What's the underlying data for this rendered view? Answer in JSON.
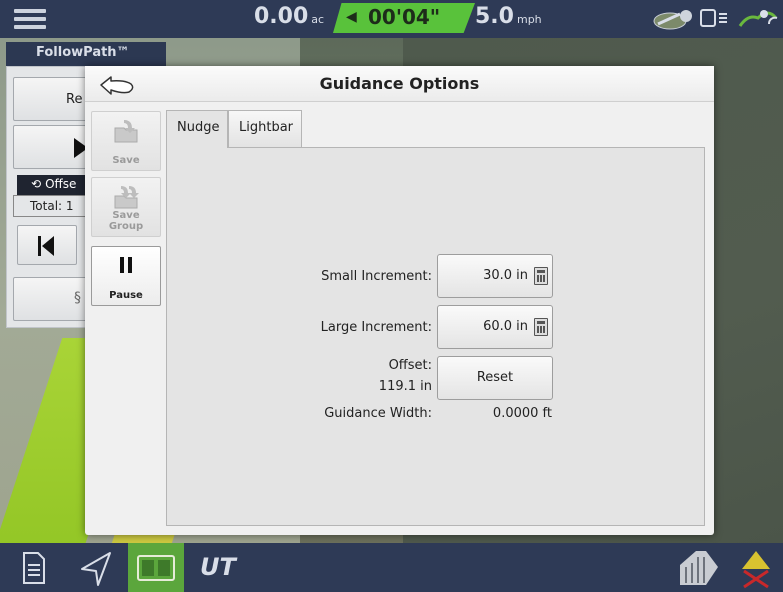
{
  "topbar": {
    "area_value": "0.00",
    "area_unit": "ac",
    "timer_value": "00'04\"",
    "speed_value": "5.0",
    "speed_unit": "mph"
  },
  "follow_path": {
    "title": "FollowPath™",
    "reset_partial": "Re",
    "offset_partial": "Offse",
    "total_partial": "Total: 1"
  },
  "dialog": {
    "title": "Guidance Options",
    "tools": {
      "save_label": "Save",
      "save_group_label": "Save Group",
      "pause_label": "Pause"
    },
    "tabs": [
      {
        "label": "Nudge",
        "selected": true
      },
      {
        "label": "Lightbar",
        "selected": false
      }
    ],
    "nudge": {
      "small_increment_label": "Small Increment:",
      "small_increment_value": "30.0 in",
      "large_increment_label": "Large Increment:",
      "large_increment_value": "60.0 in",
      "offset_label": "Offset:",
      "offset_value": "119.1 in",
      "reset_label": "Reset",
      "guidance_width_label": "Guidance Width:",
      "guidance_width_value": "0.0000 ft"
    }
  },
  "colors": {
    "topbar_bg": "#2e3a56",
    "timer_green": "#59c23b",
    "active_bottom": "#5ba63c"
  },
  "bottombar": {
    "ut_label": "UT"
  }
}
